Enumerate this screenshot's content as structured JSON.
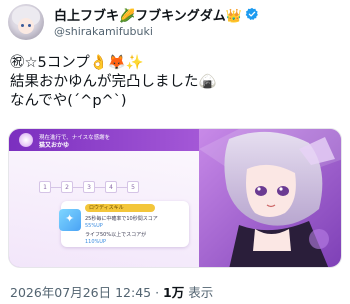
{
  "tweet": {
    "display_name": "白上フブキ🌽フブキングダム👑",
    "handle": "@shirakamifubuki",
    "text": "㊗☆5コンプ👌🦊✨\n結果おかゆんが完凸しました🍙\nなんでや(´^p^`)",
    "timestamp": "2026年07月26日 12:45 · ",
    "views_count": "1万",
    "views_label": " 表示"
  },
  "media": {
    "header_caption": "現在進行で、ナイスな感謝を",
    "header_title": "猫又おかゆ",
    "steps": [
      "1",
      "2",
      "3",
      "4",
      "5"
    ],
    "card_head": "ロウディスキル",
    "card_lines": [
      "25秒毎に中確率で10秒間スコア",
      "55%UP",
      "ライフ50%以上でスコアが",
      "110%UP"
    ]
  },
  "colors": {
    "verified": "#1d9bf0",
    "accent_purple": "#a65ad8"
  },
  "icons": {
    "verified": "verified-badge-icon"
  }
}
